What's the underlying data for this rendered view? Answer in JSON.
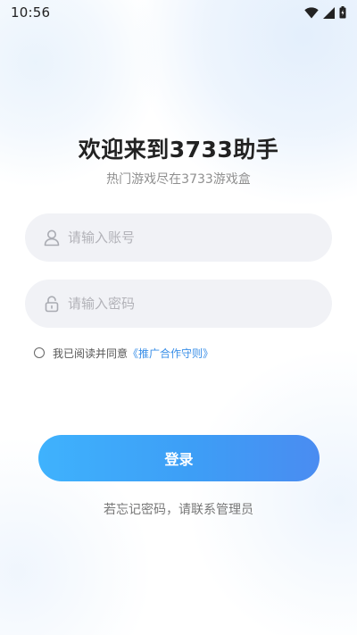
{
  "status_bar": {
    "time": "10:56",
    "icons": [
      "wifi-icon",
      "signal-icon",
      "battery-icon"
    ]
  },
  "header": {
    "title": "欢迎来到3733助手",
    "subtitle": "热门游戏尽在3733游戏盒"
  },
  "form": {
    "account": {
      "icon": "user-icon",
      "placeholder": "请输入账号",
      "value": ""
    },
    "password": {
      "icon": "lock-icon",
      "placeholder": "请输入密码",
      "value": ""
    }
  },
  "agreement": {
    "checked": false,
    "text": "我已阅读并同意",
    "link_text": "《推广合作守则》"
  },
  "login_button": {
    "label": "登录"
  },
  "footer": {
    "forgot_text": "若忘记密码，请联系管理员"
  },
  "colors": {
    "accent": "#3d9ef6",
    "link": "#3a8fe8",
    "field_bg": "#f1f2f6",
    "title": "#222222",
    "subtitle": "#8f8f8f"
  }
}
